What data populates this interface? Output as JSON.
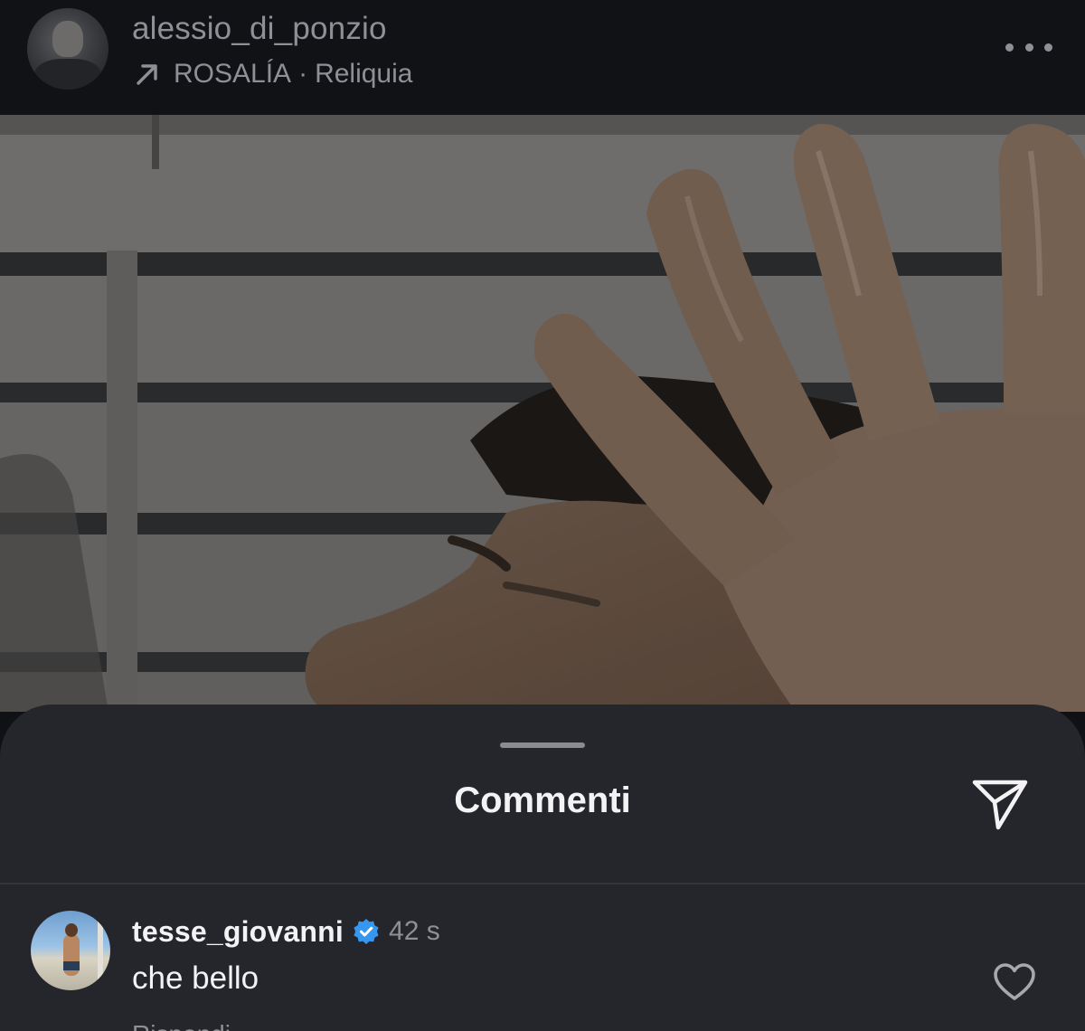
{
  "post": {
    "username": "alessio_di_ponzio",
    "music_artist": "ROSALÍA",
    "music_separator": "·",
    "music_track": "Reliquia"
  },
  "sheet": {
    "title": "Commenti"
  },
  "comments": [
    {
      "username": "tesse_giovanni",
      "verified": true,
      "time": "42 s",
      "text": "che bello",
      "reply_label": "Rispondi"
    }
  ],
  "icons": {
    "music": "arrow-up-right-icon",
    "more": "more-horizontal-icon",
    "send": "send-icon",
    "verified": "verified-badge-icon",
    "like": "heart-icon"
  },
  "colors": {
    "header_bg": "#101216",
    "sheet_bg": "#25262b",
    "primary_text": "#f3f3f5",
    "secondary_text": "#8e9095",
    "verified_blue": "#3797f0"
  }
}
